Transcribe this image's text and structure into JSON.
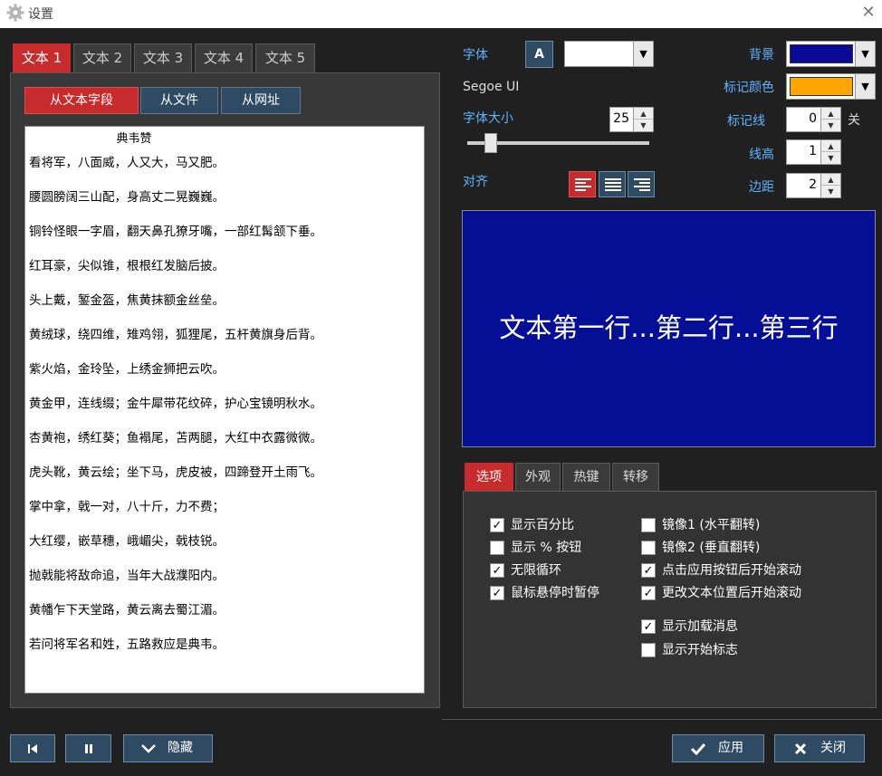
{
  "window": {
    "title": "设置",
    "close": "✕",
    "icon": "gear-icon"
  },
  "text_tabs": [
    "文本 1",
    "文本 2",
    "文本 3",
    "文本 4",
    "文本 5"
  ],
  "source_buttons": [
    "从文本字段",
    "从文件",
    "从网址"
  ],
  "text_content": {
    "title": "典韦赞",
    "lines": [
      "看将军，八面威，人又大，马又肥。",
      "腰圆膀阔三山配，身高丈二晃巍巍。",
      "铜铃怪眼一字眉，翻天鼻孔獠牙嘴，一部红髯颔下垂。",
      "红耳豪，尖似锥，根根红发脑后披。",
      "头上戴，錾金盔，焦黄抹额金丝垒。",
      "黄绒球，绕四维，雉鸡翎，狐狸尾，五杆黄旗身后背。",
      "紫火焰，金玲坠，上绣金狮把云吹。",
      "黄金甲，连线缀；金牛犀带花纹碎，护心宝镜明秋水。",
      "杏黄袍，绣红葵；鱼褟尾，苫两腿，大红中衣露微微。",
      "虎头靴，黄云绘；坐下马，虎皮被，四蹄登开土雨飞。",
      "掌中拿，戟一对，八十斤，力不费；",
      "大红缨，嵌草穗，峨嵋尖，戟枝锐。",
      "抛戟能将敌命追，当年大战濮阳内。",
      "黄幡乍下天堂路，黄云离去蜀江湄。",
      "若问将军名和姓，五路救应是典韦。"
    ]
  },
  "settings": {
    "font_label": "字体",
    "font_icon_text": "A",
    "font_name": "Segoe UI",
    "font_size_label": "字体大小",
    "font_size": "25",
    "font_size_slider_fraction": 0.13,
    "align_label": "对齐",
    "align_selected": "left",
    "background_label": "背景",
    "background_color": "#0a0a96",
    "mark_color_label": "标记颜色",
    "mark_color": "#ffa500",
    "mark_line_label": "标记线",
    "mark_line": "0",
    "mark_line_state": "关",
    "line_height_label": "线高",
    "line_height": "1",
    "margin_label": "边距",
    "margin": "2"
  },
  "preview": {
    "text": "文本第一行...第二行...第三行"
  },
  "option_tabs": [
    "选项",
    "外观",
    "热键",
    "转移"
  ],
  "options_left": [
    {
      "label": "显示百分比",
      "checked": true
    },
    {
      "label": "显示 % 按钮",
      "checked": false
    },
    {
      "label": "无限循环",
      "checked": true
    },
    {
      "label": "鼠标悬停时暂停",
      "checked": true
    }
  ],
  "options_right": [
    {
      "label": "镜像1 (水平翻转)",
      "checked": false
    },
    {
      "label": "镜像2 (垂直翻转)",
      "checked": false
    },
    {
      "label": "点击应用按钮后开始滚动",
      "checked": true
    },
    {
      "label": "更改文本位置后开始滚动",
      "checked": true
    }
  ],
  "options_extra": [
    {
      "label": "显示加载消息",
      "checked": true
    },
    {
      "label": "显示开始标志",
      "checked": false
    }
  ],
  "bottom": {
    "hide_label": "隐藏",
    "apply_label": "应用",
    "close_label": "关闭"
  }
}
